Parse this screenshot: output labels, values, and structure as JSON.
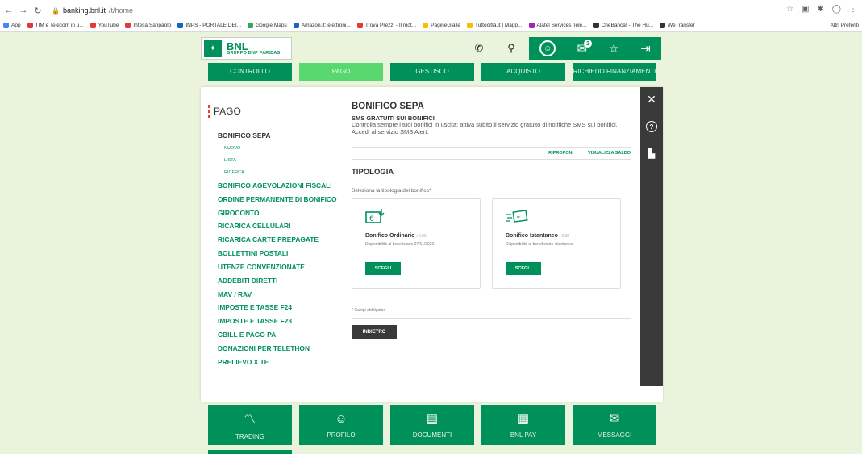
{
  "browser": {
    "url_host": "banking.bnl.it",
    "url_path": "/t/home",
    "bookmarks": [
      "App",
      "TIM e Telecom in u...",
      "YouTube",
      "Intesa Sanpaolo",
      "INPS - PORTALE DEI...",
      "Google Maps",
      "Amazon.it: elettroni...",
      "Trova Prezzi - Il mot...",
      "PagineGialle",
      "Tuttocittà.it | Mapp...",
      "Alatel Services Tele...",
      "CheBanca! - The Hu...",
      "WeTransfer"
    ],
    "bookmarks_right": "Altri Preferiti"
  },
  "brand": {
    "name": "BNL",
    "tagline": "GRUPPO BNP PARIBAS"
  },
  "header": {
    "message_count": "2"
  },
  "main_nav": [
    "CONTROLLO",
    "PAGO",
    "GESTISCO",
    "ACQUISTO",
    "RICHIEDO FINANZIAMENTI"
  ],
  "sidebar": {
    "title": "PAGO",
    "items": [
      {
        "label": "BONIFICO SEPA",
        "type": "current"
      },
      {
        "label": "NUOVO",
        "type": "sub"
      },
      {
        "label": "LISTA",
        "type": "sub"
      },
      {
        "label": "RICERCA",
        "type": "sub"
      },
      {
        "label": "BONIFICO AGEVOLAZIONI FISCALI",
        "type": "item"
      },
      {
        "label": "ORDINE PERMANENTE DI BONIFICO",
        "type": "item"
      },
      {
        "label": "GIROCONTO",
        "type": "item"
      },
      {
        "label": "RICARICA CELLULARI",
        "type": "item"
      },
      {
        "label": "RICARICA CARTE PREPAGATE",
        "type": "item"
      },
      {
        "label": "BOLLETTINI POSTALI",
        "type": "item"
      },
      {
        "label": "UTENZE CONVENZIONATE",
        "type": "item"
      },
      {
        "label": "ADDEBITI DIRETTI",
        "type": "item"
      },
      {
        "label": "MAV / RAV",
        "type": "item"
      },
      {
        "label": "IMPOSTE E TASSE F24",
        "type": "item"
      },
      {
        "label": "IMPOSTE E TASSE F23",
        "type": "item"
      },
      {
        "label": "CBILL E PAGO PA",
        "type": "item"
      },
      {
        "label": "DONAZIONI PER TELETHON",
        "type": "item"
      },
      {
        "label": "PRELIEVO X TE",
        "type": "item"
      }
    ]
  },
  "content": {
    "title": "BONIFICO SEPA",
    "sms_title": "SMS GRATUITI SUI BONIFICI",
    "sms_text": "Controlla sempre i tuoi bonifici in uscita: attiva subito il servizio gratuito di notifiche SMS sui bonifici. Accedi al servizio SMS Alert.",
    "action_repeat": "RIPROPONI",
    "action_balance": "VISUALIZZA SALDO",
    "tipologia_title": "TIPOLOGIA",
    "tipologia_sub": "Seleziona la tipologia del bonifico*",
    "cards": [
      {
        "name": "Bonifico Ordinario",
        "note": "i 0,00",
        "availability": "Disponibilità al beneficiario 07/11/2020",
        "button": "SCEGLI"
      },
      {
        "name": "Bonifico Istantaneo",
        "note": "i 0,00",
        "availability": "Disponibilità al beneficiario istantanea",
        "button": "SCEGLI"
      }
    ],
    "required_note": "* Campi obbligatori",
    "back_button": "INDIETRO"
  },
  "bottom_tiles": [
    "TRADING",
    "PROFILO",
    "DOCUMENTI",
    "BNL PAY",
    "MESSAGGI"
  ]
}
